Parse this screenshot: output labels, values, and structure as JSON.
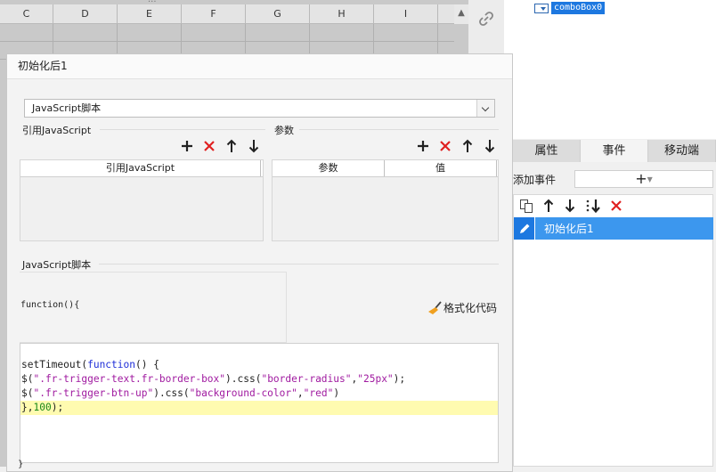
{
  "sheet": {
    "columns": [
      "C",
      "D",
      "E",
      "F",
      "G",
      "H",
      "I"
    ],
    "drag_handle": "...",
    "scroll_up": "▲"
  },
  "widget_tree": {
    "item": "comboBox0"
  },
  "panel": {
    "tabs": [
      "属性",
      "事件",
      "移动端"
    ],
    "active_tab": "事件",
    "add_event_label": "添加事件",
    "add_event_symbol": "+",
    "events": [
      {
        "label": "初始化后1"
      }
    ],
    "toolbar_icons": [
      "copy-icon",
      "move-up-icon",
      "move-down-icon",
      "sort-icon",
      "delete-icon"
    ]
  },
  "dialog": {
    "title": "初始化后1",
    "script_type": "JavaScript脚本",
    "import_section_label": "引用JavaScript",
    "params_section_label": "参数",
    "import_table_header": "引用JavaScript",
    "params_table_headers": [
      "参数",
      "值"
    ],
    "script_section_label": "JavaScript脚本",
    "function_signature": "function(){",
    "format_button": "格式化代码",
    "closing_brace": "}"
  },
  "code": {
    "lines": [
      "",
      "setTimeout(function() {",
      "$(\".fr-trigger-text.fr-border-box\").css(\"border-radius\",\"25px\");",
      "$(\".fr-trigger-btn-up\").css(\"background-color\",\"red\")",
      "},100);"
    ],
    "highlighted_line": 4
  },
  "colors": {
    "accent": "#1d78e0",
    "delete": "#e02020",
    "highlight": "#fffbb0"
  }
}
